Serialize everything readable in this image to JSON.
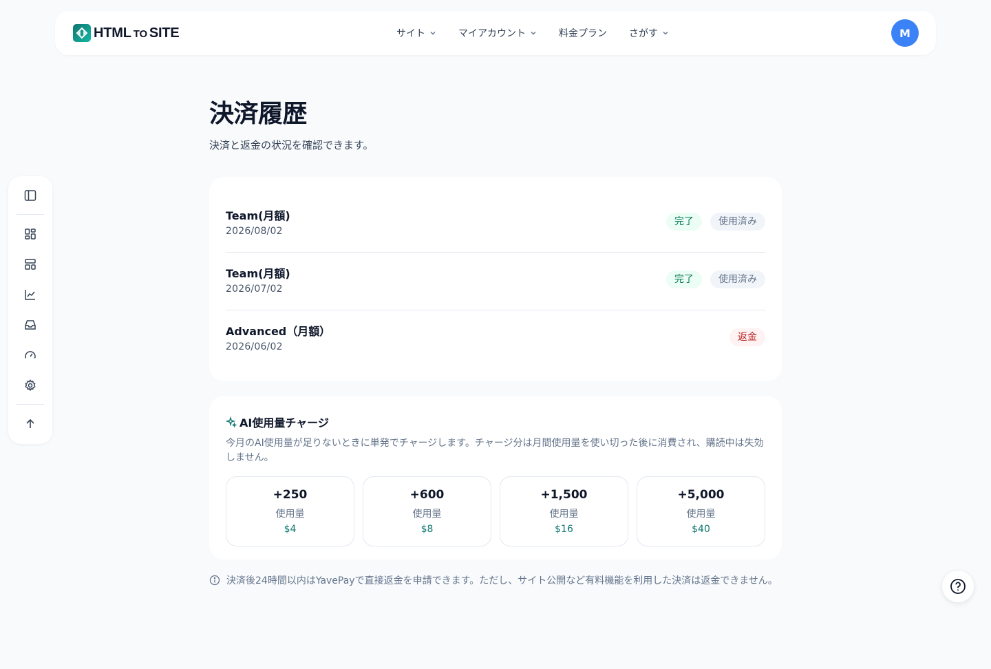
{
  "brand": {
    "logo_main": "HTML",
    "logo_to": "TO",
    "logo_site": "SITE"
  },
  "nav": {
    "items": [
      {
        "label": "サイト",
        "has_dropdown": true
      },
      {
        "label": "マイアカウント",
        "has_dropdown": true
      },
      {
        "label": "料金プラン",
        "has_dropdown": false
      },
      {
        "label": "さがす",
        "has_dropdown": true
      }
    ],
    "avatar_initial": "M"
  },
  "sidebar": {
    "icons": [
      "sidebar-toggle-icon",
      "dashboard-icon",
      "layout-icon",
      "chart-icon",
      "inbox-icon",
      "gauge-icon",
      "gear-icon",
      "arrow-up-icon"
    ]
  },
  "page": {
    "title": "決済履歴",
    "subtitle": "決済と返金の状況を確認できます。"
  },
  "history": {
    "rows": [
      {
        "plan": "Team(月額)",
        "date": "2026/08/02",
        "badges": [
          {
            "text": "完了",
            "kind": "ok"
          },
          {
            "text": "使用済み",
            "kind": "used"
          }
        ]
      },
      {
        "plan": "Team(月額)",
        "date": "2026/07/02",
        "badges": [
          {
            "text": "完了",
            "kind": "ok"
          },
          {
            "text": "使用済み",
            "kind": "used"
          }
        ]
      },
      {
        "plan": "Advanced（月額）",
        "date": "2026/06/02",
        "badges": [
          {
            "text": "返金",
            "kind": "refund"
          }
        ]
      }
    ]
  },
  "charge": {
    "title": "AI使用量チャージ",
    "description": "今月のAI使用量が足りないときに単発でチャージします。チャージ分は月間使用量を使い切った後に消費され、購読中は失効しません。",
    "packs": [
      {
        "amount": "+250",
        "label": "使用量",
        "price": "$4"
      },
      {
        "amount": "+600",
        "label": "使用量",
        "price": "$8"
      },
      {
        "amount": "+1,500",
        "label": "使用量",
        "price": "$16"
      },
      {
        "amount": "+5,000",
        "label": "使用量",
        "price": "$40"
      }
    ]
  },
  "note": "決済後24時間以内はYavePayで直接返金を申請できます。ただし、サイト公開など有料機能を利用した決済は返金できません。",
  "colors": {
    "accent": "#0f766e",
    "avatar": "#3b82f6",
    "ok_badge": "#047857",
    "refund_badge": "#b91c1c",
    "background": "#f8fafc"
  }
}
